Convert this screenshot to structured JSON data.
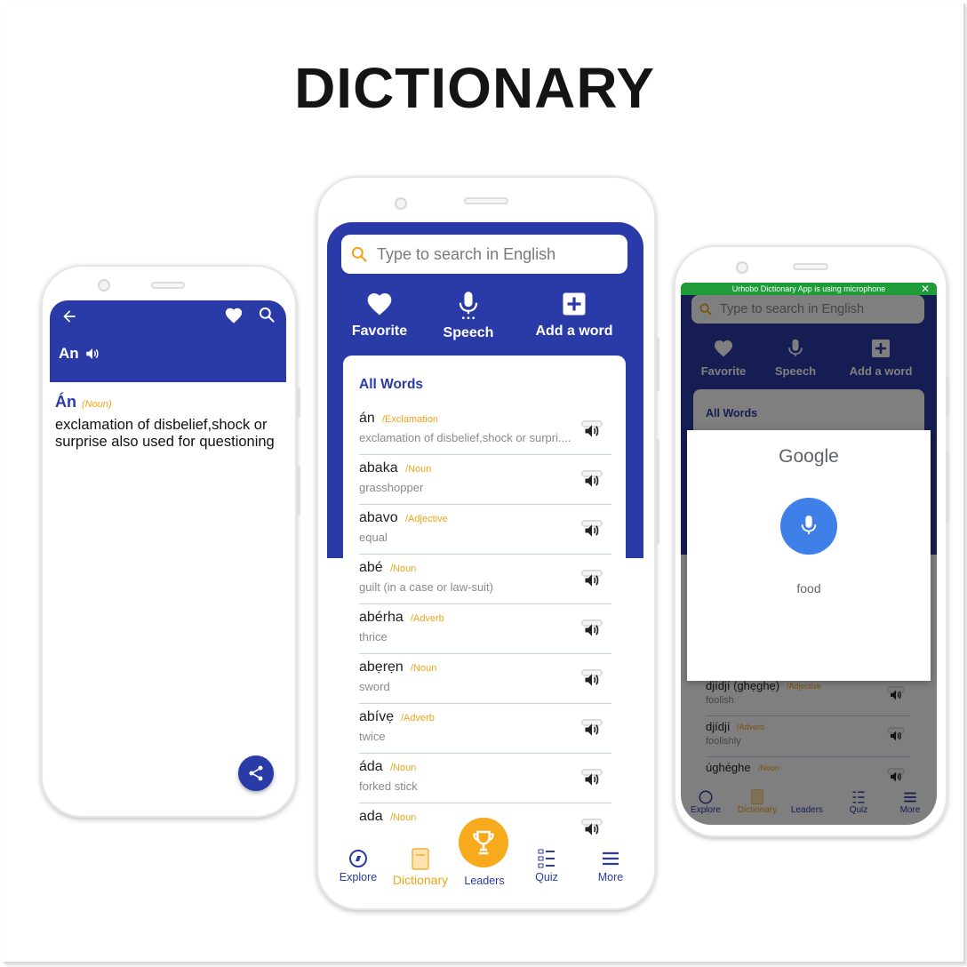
{
  "page_title": "DICTIONARY",
  "colors": {
    "primary": "#2a3aa6",
    "accent": "#f3a316",
    "google_mic": "#3f80e8",
    "mic_bar": "#1f9b3a"
  },
  "left_screen": {
    "header_word": "An",
    "entry": {
      "word": "Án",
      "pos": "(Noun)",
      "definition": "exclamation of disbelief,shock or surprise also used for questioning"
    },
    "icons": [
      "back-arrow-icon",
      "heart-icon",
      "search-icon",
      "speaker-icon",
      "share-icon"
    ]
  },
  "center_screen": {
    "search_placeholder": "Type to search in English",
    "actions": [
      {
        "label": "Favorite",
        "icon": "heart-icon"
      },
      {
        "label": "Speech",
        "icon": "microphone-icon"
      },
      {
        "label": "Add a word",
        "icon": "plus-box-icon"
      }
    ],
    "list_title": "All Words",
    "words": [
      {
        "word": "án",
        "pos": "/Exclamation",
        "def": "exclamation of disbelief,shock or surpri...."
      },
      {
        "word": "abaka",
        "pos": "/Noun",
        "def": "grasshopper"
      },
      {
        "word": "abavo",
        "pos": "/Adjective",
        "def": "equal"
      },
      {
        "word": "abé",
        "pos": "/Noun",
        "def": "guilt (in a case or law-suit)"
      },
      {
        "word": "abérha",
        "pos": "/Adverb",
        "def": "thrice"
      },
      {
        "word": "abẹrẹn",
        "pos": "/Noun",
        "def": "sword"
      },
      {
        "word": "abívẹ",
        "pos": "/Adverb",
        "def": "twice"
      },
      {
        "word": "áda",
        "pos": "/Noun",
        "def": "forked stick"
      },
      {
        "word": "ada",
        "pos": "/Noun",
        "def": ""
      }
    ],
    "nav": [
      {
        "label": "Explore",
        "icon": "compass-icon"
      },
      {
        "label": "Dictionary",
        "icon": "book-icon"
      },
      {
        "label": "Leaders",
        "icon": "trophy-icon"
      },
      {
        "label": "Quiz",
        "icon": "quiz-list-icon"
      },
      {
        "label": "More",
        "icon": "menu-icon"
      }
    ]
  },
  "right_screen": {
    "mic_notice": "Urhobo Dictionary App is using microphone",
    "search_placeholder": "Type to search in English",
    "actions": [
      "Favorite",
      "Speech",
      "Add a word"
    ],
    "list_title": "All Words",
    "words": [
      {
        "word": "djídjí (ghẹghẹ)",
        "pos": "/Adjective",
        "def": "foolish"
      },
      {
        "word": "djídjí",
        "pos": "/Adverb",
        "def": "foolishly"
      },
      {
        "word": "úghéghe",
        "pos": "/Noun",
        "def": ""
      }
    ],
    "dialog": {
      "brand": "Google",
      "query": "food"
    },
    "nav": [
      "Explore",
      "Dictionary",
      "Leaders",
      "Quiz",
      "More"
    ]
  }
}
